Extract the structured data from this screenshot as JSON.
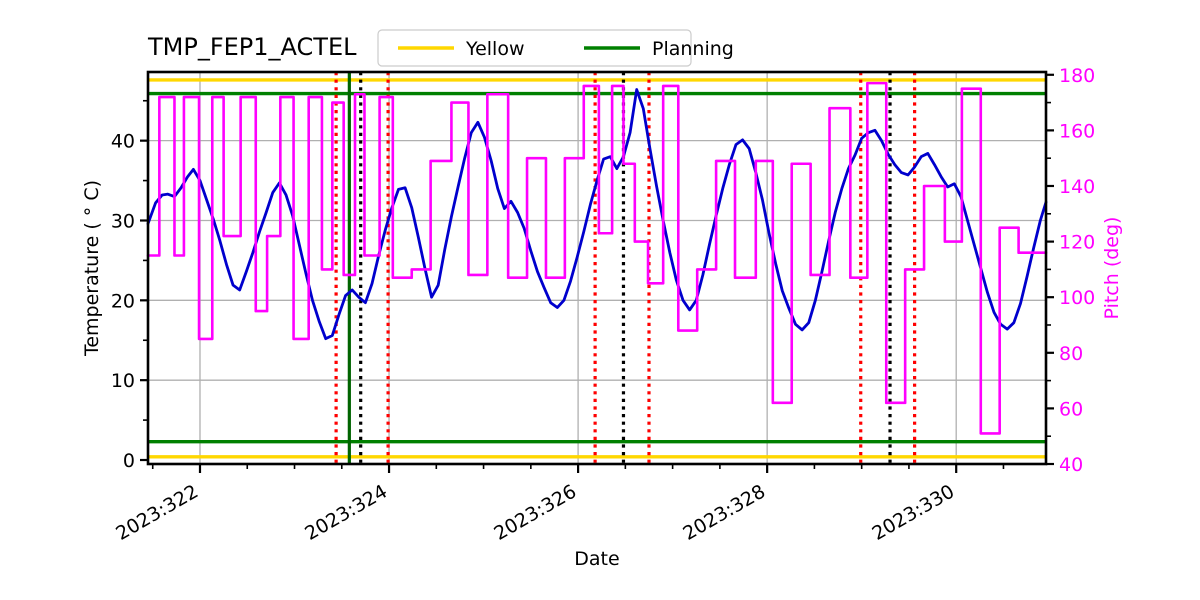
{
  "chart_data": {
    "type": "line",
    "title": "TMP_FEP1_ACTEL",
    "xlabel": "Date",
    "ylabel": "Temperature ( ° C)",
    "ylabel_right": "Pitch (deg)",
    "xtick_labels": [
      "2023:322",
      "2023:324",
      "2023:326",
      "2023:328",
      "2023:330"
    ],
    "xtick_positions": [
      322,
      324,
      326,
      328,
      330
    ],
    "xlim": [
      321.45,
      330.95
    ],
    "ylim": [
      -0.5,
      48.6
    ],
    "ytick_labels": [
      "0",
      "10",
      "20",
      "30",
      "40"
    ],
    "yticks": [
      0,
      10,
      20,
      30,
      40
    ],
    "ylim_right": [
      40,
      181
    ],
    "ytick_labels_right": [
      "40",
      "60",
      "80",
      "100",
      "120",
      "140",
      "160",
      "180"
    ],
    "yticks_right": [
      40,
      60,
      80,
      100,
      120,
      140,
      160,
      180
    ],
    "grid": true,
    "legend_position": "upper center",
    "legend": [
      {
        "label": "Yellow",
        "color": "#ffd700"
      },
      {
        "label": "Planning",
        "color": "#008000"
      }
    ],
    "series": [
      {
        "name": "Temperature",
        "color": "#0000cd",
        "axis": "left",
        "style": "solid",
        "x": [
          321.45,
          321.53,
          321.6,
          321.66,
          321.73,
          321.8,
          321.87,
          321.93,
          322.0,
          322.07,
          322.14,
          322.21,
          322.28,
          322.35,
          322.42,
          322.49,
          322.56,
          322.63,
          322.7,
          322.77,
          322.84,
          322.91,
          322.98,
          323.05,
          323.12,
          323.19,
          323.26,
          323.33,
          323.4,
          323.47,
          323.54,
          323.61,
          323.68,
          323.75,
          323.82,
          323.89,
          323.96,
          324.03,
          324.1,
          324.17,
          324.24,
          324.31,
          324.38,
          324.45,
          324.52,
          324.59,
          324.66,
          324.73,
          324.8,
          324.87,
          324.94,
          325.01,
          325.08,
          325.15,
          325.22,
          325.29,
          325.36,
          325.43,
          325.5,
          325.57,
          325.64,
          325.71,
          325.78,
          325.85,
          325.92,
          325.99,
          326.06,
          326.13,
          326.2,
          326.27,
          326.34,
          326.41,
          326.48,
          326.55,
          326.62,
          326.69,
          326.76,
          326.83,
          326.9,
          326.97,
          327.04,
          327.11,
          327.18,
          327.25,
          327.32,
          327.39,
          327.46,
          327.53,
          327.6,
          327.67,
          327.74,
          327.81,
          327.88,
          327.95,
          328.02,
          328.09,
          328.16,
          328.23,
          328.3,
          328.37,
          328.44,
          328.51,
          328.58,
          328.65,
          328.72,
          328.79,
          328.86,
          328.93,
          329.0,
          329.07,
          329.14,
          329.21,
          329.28,
          329.35,
          329.42,
          329.49,
          329.56,
          329.63,
          329.7,
          329.77,
          329.84,
          329.91,
          329.98,
          330.05,
          330.12,
          330.19,
          330.26,
          330.33,
          330.4,
          330.47,
          330.54,
          330.61,
          330.68,
          330.75,
          330.82,
          330.89,
          330.95
        ],
        "y": [
          29.6,
          32.2,
          33.2,
          33.3,
          33.0,
          34.1,
          35.5,
          36.4,
          35.0,
          32.6,
          30.2,
          27.5,
          24.5,
          21.9,
          21.3,
          23.6,
          26.0,
          28.6,
          31.0,
          33.5,
          34.7,
          33.2,
          30.6,
          27.0,
          23.4,
          20.0,
          17.4,
          15.2,
          15.6,
          18.2,
          20.6,
          21.3,
          20.4,
          19.7,
          22.1,
          25.6,
          28.8,
          31.6,
          33.9,
          34.1,
          31.6,
          27.9,
          24.0,
          20.4,
          21.9,
          26.4,
          30.5,
          34.2,
          37.8,
          41.0,
          42.3,
          40.4,
          37.5,
          34.0,
          31.5,
          32.4,
          31.0,
          29.0,
          26.2,
          23.6,
          21.6,
          19.7,
          19.1,
          20.0,
          22.4,
          25.4,
          28.6,
          32.0,
          35.0,
          37.7,
          38.0,
          36.5,
          38.0,
          41.0,
          46.4,
          44.0,
          39.0,
          34.3,
          30.0,
          26.0,
          22.5,
          20.0,
          18.8,
          20.0,
          23.2,
          27.0,
          30.6,
          34.0,
          37.0,
          39.5,
          40.1,
          39.0,
          36.0,
          32.6,
          28.4,
          24.6,
          21.2,
          19.0,
          17.0,
          16.3,
          17.2,
          20.0,
          23.6,
          27.4,
          31.0,
          34.0,
          36.5,
          38.2,
          40.3,
          41.0,
          41.3,
          40.0,
          38.3,
          37.0,
          36.0,
          35.7,
          36.7,
          38.0,
          38.4,
          37.0,
          35.5,
          34.2,
          34.6,
          33.0,
          30.0,
          27.0,
          24.0,
          21.0,
          18.5,
          17.0,
          16.4,
          17.2,
          19.6,
          23.0,
          26.6,
          30.0,
          32.3
        ],
        "note": "Temperature trace repeats a 1-day saw/oscillation between ~15 and ~46 degC across the 9.5 day window"
      },
      {
        "name": "Pitch",
        "color": "#ff00ff",
        "axis": "right",
        "style": "step",
        "x": [
          321.45,
          321.54,
          321.57,
          321.7,
          321.73,
          321.8,
          321.83,
          321.96,
          321.99,
          322.1,
          322.13,
          322.22,
          322.25,
          322.4,
          322.43,
          322.56,
          322.59,
          322.68,
          322.71,
          322.82,
          322.85,
          322.96,
          322.99,
          323.12,
          323.15,
          323.26,
          323.29,
          323.36,
          323.4,
          323.48,
          323.52,
          323.6,
          323.64,
          323.7,
          323.74,
          323.86,
          323.9,
          324.0,
          324.04,
          324.2,
          324.24,
          324.4,
          324.44,
          324.62,
          324.66,
          324.8,
          324.84,
          325.0,
          325.04,
          325.2,
          325.26,
          325.4,
          325.46,
          325.6,
          325.66,
          325.82,
          325.86,
          326.0,
          326.06,
          326.18,
          326.22,
          326.32,
          326.36,
          326.44,
          326.48,
          326.56,
          326.6,
          326.7,
          326.74,
          326.86,
          326.9,
          327.0,
          327.06,
          327.2,
          327.26,
          327.4,
          327.46,
          327.6,
          327.66,
          327.84,
          327.88,
          328.02,
          328.06,
          328.22,
          328.26,
          328.42,
          328.46,
          328.62,
          328.66,
          328.84,
          328.88,
          329.02,
          329.06,
          329.2,
          329.26,
          329.42,
          329.46,
          329.62,
          329.66,
          329.84,
          329.88,
          330.02,
          330.06,
          330.22,
          330.26,
          330.42,
          330.46,
          330.62,
          330.66,
          330.95
        ],
        "y": [
          115,
          115,
          172,
          172,
          115,
          115,
          172,
          172,
          85,
          85,
          172,
          172,
          122,
          122,
          172,
          172,
          95,
          95,
          122,
          122,
          172,
          172,
          85,
          85,
          172,
          172,
          110,
          110,
          170,
          170,
          108,
          108,
          173,
          173,
          115,
          115,
          172,
          172,
          107,
          107,
          110,
          110,
          149,
          149,
          170,
          170,
          108,
          108,
          173,
          173,
          107,
          107,
          150,
          150,
          107,
          107,
          150,
          150,
          176,
          176,
          123,
          123,
          176,
          176,
          148,
          148,
          120,
          120,
          105,
          105,
          176,
          176,
          88,
          88,
          110,
          110,
          149,
          149,
          107,
          107,
          149,
          149,
          62,
          62,
          148,
          148,
          108,
          108,
          168,
          168,
          107,
          107,
          177,
          177,
          62,
          62,
          110,
          110,
          140,
          140,
          120,
          120,
          175,
          175,
          51,
          51,
          125,
          125,
          116,
          116
        ],
        "note": "Pitch is a piecewise-constant (step) trace dwelling at discrete pointing angles between ~50 and ~177 deg"
      }
    ],
    "horizontal_limit_lines": [
      {
        "name": "yellow-upper",
        "value": 47.6,
        "color": "#ffd700",
        "style": "solid",
        "axis": "left"
      },
      {
        "name": "green-upper",
        "value": 45.9,
        "color": "#008000",
        "style": "solid",
        "axis": "left"
      },
      {
        "name": "green-lower",
        "value": 2.3,
        "color": "#008000",
        "style": "solid",
        "axis": "left"
      },
      {
        "name": "yellow-lower",
        "value": 0.4,
        "color": "#ffd700",
        "style": "solid",
        "axis": "left"
      }
    ],
    "vertical_marker_lines": [
      {
        "x": 323.44,
        "color": "#ff0000",
        "style": "dotted"
      },
      {
        "x": 323.58,
        "color": "#006400",
        "style": "solid"
      },
      {
        "x": 323.7,
        "color": "#000000",
        "style": "dotted"
      },
      {
        "x": 323.99,
        "color": "#ff0000",
        "style": "dotted"
      },
      {
        "x": 326.18,
        "color": "#ff0000",
        "style": "dotted"
      },
      {
        "x": 326.48,
        "color": "#000000",
        "style": "dotted"
      },
      {
        "x": 326.75,
        "color": "#ff0000",
        "style": "dotted"
      },
      {
        "x": 328.99,
        "color": "#ff0000",
        "style": "dotted"
      },
      {
        "x": 329.3,
        "color": "#000000",
        "style": "dotted"
      },
      {
        "x": 329.56,
        "color": "#ff0000",
        "style": "dotted"
      }
    ],
    "colors": {
      "temperature": "#0000cd",
      "pitch": "#ff00ff",
      "yellow_limit": "#ffd700",
      "planning_limit": "#008000",
      "marker_red": "#ff0000",
      "marker_black": "#000000",
      "grid": "#b0b0b0",
      "axis": "#000000"
    }
  }
}
